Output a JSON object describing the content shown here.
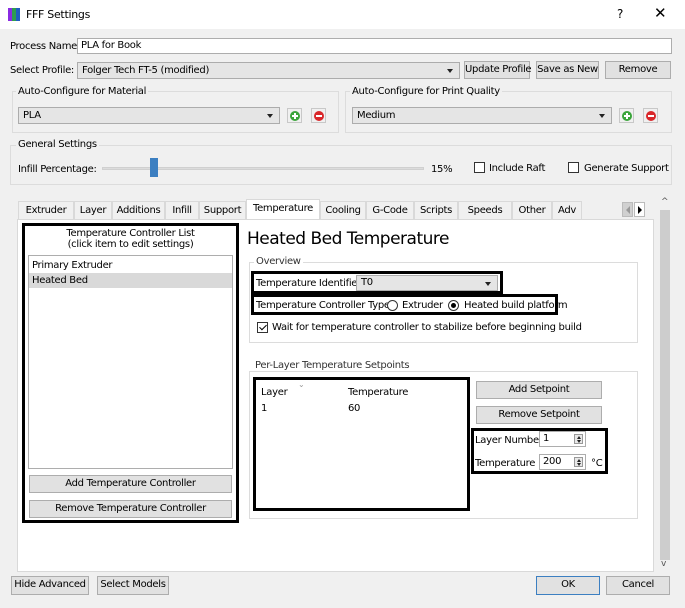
{
  "window": {
    "title": "FFF Settings",
    "help_label": "?",
    "close_label": "✕"
  },
  "process": {
    "label": "Process Name:",
    "value": "PLA for Book"
  },
  "profile": {
    "label": "Select Profile:",
    "value": "Folger Tech FT-5 (modified)",
    "update_label": "Update Profile",
    "save_as_new_label": "Save as New",
    "remove_label": "Remove"
  },
  "material": {
    "title": "Auto-Configure for Material",
    "value": "PLA"
  },
  "quality": {
    "title": "Auto-Configure for Print Quality",
    "value": "Medium"
  },
  "general": {
    "title": "General Settings",
    "infill_label": "Infill Percentage:",
    "infill_value": "15%",
    "infill_percent": 15,
    "include_raft_label": "Include Raft",
    "include_raft_checked": false,
    "generate_support_label": "Generate Support",
    "generate_support_checked": false
  },
  "tabs": [
    {
      "label": "Extruder"
    },
    {
      "label": "Layer"
    },
    {
      "label": "Additions"
    },
    {
      "label": "Infill"
    },
    {
      "label": "Support"
    },
    {
      "label": "Temperature",
      "active": true
    },
    {
      "label": "Cooling"
    },
    {
      "label": "G-Code"
    },
    {
      "label": "Scripts"
    },
    {
      "label": "Speeds"
    },
    {
      "label": "Other"
    },
    {
      "label": "Adv"
    }
  ],
  "controller_list": {
    "title_line1": "Temperature Controller List",
    "title_line2": "(click item to edit settings)",
    "items": [
      {
        "label": "Primary Extruder"
      },
      {
        "label": "Heated Bed",
        "selected": true
      }
    ],
    "add_label": "Add Temperature Controller",
    "remove_label": "Remove Temperature Controller"
  },
  "detail": {
    "heading": "Heated Bed Temperature",
    "overview_title": "Overview",
    "identifier_label": "Temperature Identifier",
    "identifier_value": "T0",
    "type_label": "Temperature Controller Type:",
    "type_options": [
      {
        "label": "Extruder",
        "checked": false
      },
      {
        "label": "Heated build platform",
        "checked": true
      }
    ],
    "wait_label": "Wait for temperature controller to stabilize before beginning build",
    "wait_checked": true,
    "setpoints_title": "Per-Layer Temperature Setpoints",
    "columns": [
      "Layer",
      "Temperature"
    ],
    "rows": [
      [
        "1",
        "60"
      ]
    ],
    "add_setpoint_label": "Add Setpoint",
    "remove_setpoint_label": "Remove Setpoint",
    "layer_number_label": "Layer Number",
    "layer_number_value": "1",
    "temperature_label": "Temperature",
    "temperature_value": "200",
    "temperature_unit": "°C"
  },
  "footer": {
    "hide_advanced_label": "Hide Advanced",
    "select_models_label": "Select Models",
    "ok_label": "OK",
    "cancel_label": "Cancel"
  },
  "colors": {
    "accent": "#3c7fc1",
    "add": "#3aa43a",
    "remove": "#d9272a"
  }
}
